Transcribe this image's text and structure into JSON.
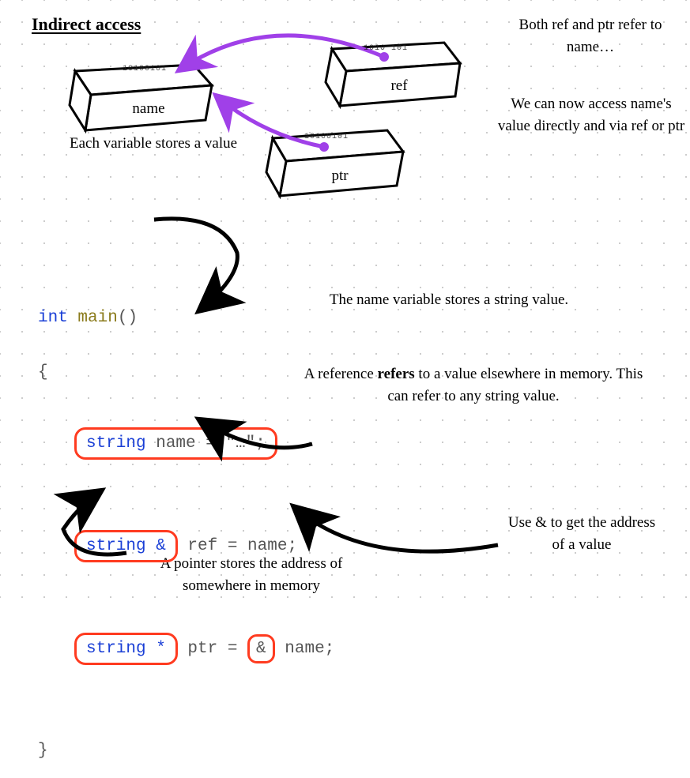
{
  "title": "Indirect access",
  "top_annotations": {
    "right1": "Both ref and ptr refer to name…",
    "right2": "We can now access name's value directly and via ref or ptr",
    "left1": "Each variable stores a value"
  },
  "boxes": {
    "name": {
      "label": "name",
      "binary": "10100101"
    },
    "ref": {
      "label": "ref",
      "binary": "1010 101"
    },
    "ptr": {
      "label": "ptr",
      "binary": "10100101"
    }
  },
  "code": {
    "line1_type": "int",
    "line1_fn": "main",
    "line1_rest": "()",
    "brace_open": "{",
    "decl_name_type": "string",
    "decl_name_rest": " name = \"…\";",
    "decl_ref_type": "string &",
    "decl_ref_rest": " ref = name;",
    "decl_ptr_type": "string *",
    "decl_ptr_mid": " ptr = ",
    "decl_ptr_amp": "&",
    "decl_ptr_end": " name;",
    "brace_close": "}"
  },
  "annotations": {
    "name_var": "The name variable stores a string value.",
    "reference": "A reference refers to a value elsewhere in memory. This can refer to any string value.",
    "reference_bold": "refers",
    "ptr_addr": "Use & to get the address of a value",
    "ptr_stores": "A pointer stores the address of somewhere in memory"
  }
}
